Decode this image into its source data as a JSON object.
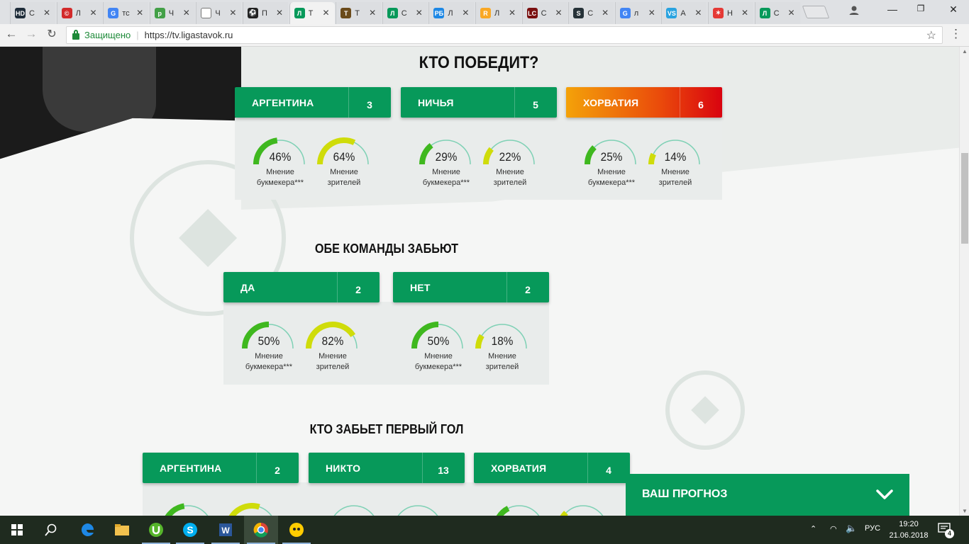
{
  "browser": {
    "tabs": [
      {
        "icon": "hd-icon",
        "fav_text": "HD",
        "fav_color": "#1f2d3a",
        "title": "С"
      },
      {
        "icon": "copyright-icon",
        "fav_text": "©",
        "fav_color": "#d22a2a",
        "title": "Л"
      },
      {
        "icon": "google-icon",
        "fav_text": "G",
        "fav_color": "#4285f4",
        "title": "тс"
      },
      {
        "icon": "leaf-icon",
        "fav_text": "р",
        "fav_color": "#43a047",
        "title": "Ч"
      },
      {
        "icon": "document-icon",
        "fav_text": "",
        "fav_color": "#ffffff",
        "title": "Ч"
      },
      {
        "icon": "soccer-ball-icon",
        "fav_text": "⚽",
        "fav_color": "#222222",
        "title": "П"
      },
      {
        "icon": "ligastavok-icon",
        "fav_text": "Л",
        "fav_color": "#07995a",
        "title": "Т"
      },
      {
        "icon": "shield-icon",
        "fav_text": "T",
        "fav_color": "#6b4b1b",
        "title": "Т"
      },
      {
        "icon": "ligastavok-icon",
        "fav_text": "Л",
        "fav_color": "#07995a",
        "title": "С"
      },
      {
        "icon": "rb-icon",
        "fav_text": "РБ",
        "fav_color": "#1e88e5",
        "title": "Л"
      },
      {
        "icon": "r-icon",
        "fav_text": "R",
        "fav_color": "#f9a825",
        "title": "Л"
      },
      {
        "icon": "lc-icon",
        "fav_text": "LC",
        "fav_color": "#7a1010",
        "title": "С"
      },
      {
        "icon": "s-icon",
        "fav_text": "S",
        "fav_color": "#263238",
        "title": "С"
      },
      {
        "icon": "google-icon",
        "fav_text": "G",
        "fav_color": "#4285f4",
        "title": "л"
      },
      {
        "icon": "vs-icon",
        "fav_text": "VS",
        "fav_color": "#29a3e0",
        "title": "А"
      },
      {
        "icon": "stars-icon",
        "fav_text": "✶",
        "fav_color": "#e53935",
        "title": "Н"
      },
      {
        "icon": "ligastavok-icon",
        "fav_text": "Л",
        "fav_color": "#07995a",
        "title": "С"
      }
    ],
    "tab_close": "✕",
    "secure_label": "Защищено",
    "url": "https://tv.ligastavok.ru"
  },
  "who_wins": {
    "title": "КТО ПОБЕДИТ?",
    "options": [
      {
        "label": "АРГЕНТИНА",
        "count": "3",
        "style": "green",
        "bookmaker": {
          "pct": "46%",
          "value": 0.46,
          "cap1": "Мнение",
          "cap2": "букмекера***"
        },
        "viewers": {
          "pct": "64%",
          "value": 0.64,
          "cap1": "Мнение",
          "cap2": "зрителей"
        }
      },
      {
        "label": "НИЧЬЯ",
        "count": "5",
        "style": "green",
        "bookmaker": {
          "pct": "29%",
          "value": 0.29,
          "cap1": "Мнение",
          "cap2": "букмекера***"
        },
        "viewers": {
          "pct": "22%",
          "value": 0.22,
          "cap1": "Мнение",
          "cap2": "зрителей"
        }
      },
      {
        "label": "ХОРВАТИЯ",
        "count": "6",
        "style": "orange",
        "bookmaker": {
          "pct": "25%",
          "value": 0.25,
          "cap1": "Мнение",
          "cap2": "букмекера***"
        },
        "viewers": {
          "pct": "14%",
          "value": 0.14,
          "cap1": "Мнение",
          "cap2": "зрителей"
        }
      }
    ]
  },
  "both_score": {
    "title": "ОБЕ КОМАНДЫ ЗАБЬЮТ",
    "options": [
      {
        "label": "ДА",
        "count": "2",
        "style": "green",
        "bookmaker": {
          "pct": "50%",
          "value": 0.5,
          "cap1": "Мнение",
          "cap2": "букмекера***"
        },
        "viewers": {
          "pct": "82%",
          "value": 0.82,
          "cap1": "Мнение",
          "cap2": "зрителей"
        }
      },
      {
        "label": "НЕТ",
        "count": "2",
        "style": "green",
        "bookmaker": {
          "pct": "50%",
          "value": 0.5,
          "cap1": "Мнение",
          "cap2": "букмекера***"
        },
        "viewers": {
          "pct": "18%",
          "value": 0.18,
          "cap1": "Мнение",
          "cap2": "зрителей"
        }
      }
    ]
  },
  "first_goal": {
    "title": "КТО ЗАБЬЕТ ПЕРВЫЙ ГОЛ",
    "options": [
      {
        "label": "АРГЕНТИНА",
        "count": "2",
        "style": "green",
        "gauges": [
          0.45,
          0.6
        ]
      },
      {
        "label": "НИКТО",
        "count": "13",
        "style": "green",
        "gauges": [
          0.0,
          0.0
        ]
      },
      {
        "label": "ХОРВАТИЯ",
        "count": "4",
        "style": "green",
        "gauges": [
          0.35,
          0.25
        ]
      }
    ]
  },
  "forecast": {
    "label": "ВАШ ПРОГНОЗ"
  },
  "colors": {
    "brand_green": "#07995a",
    "gauge_green": "#3fb81f",
    "gauge_yellow": "#cfdc0a",
    "gauge_track": "#7fd1b5"
  },
  "taskbar": {
    "apps": [
      "start-icon",
      "search-icon",
      "edge-icon",
      "file-explorer-icon",
      "utorrent-icon",
      "skype-icon",
      "word-icon",
      "chrome-icon",
      "cyberghost-icon"
    ],
    "language": "РУС",
    "time": "19:20",
    "date": "21.06.2018",
    "notifications": "4"
  }
}
